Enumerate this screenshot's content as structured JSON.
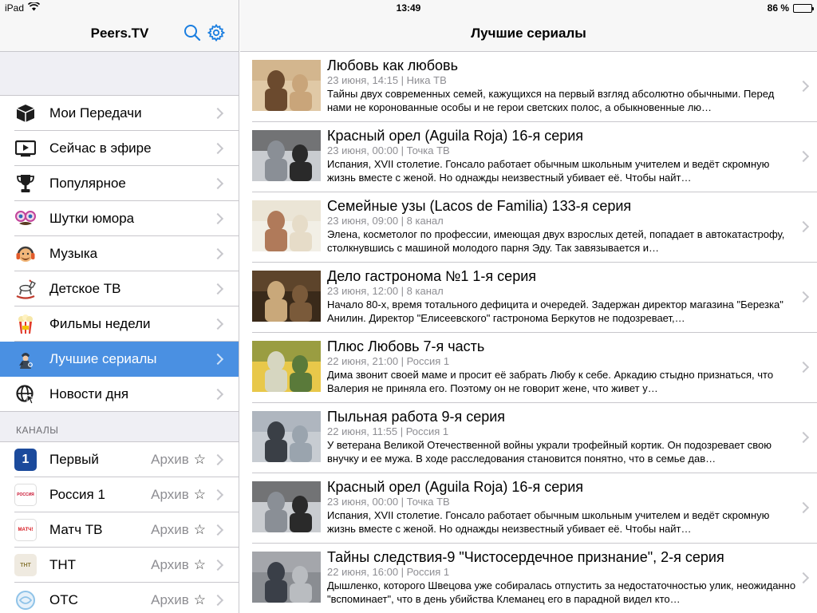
{
  "status": {
    "device": "iPad",
    "time": "13:49",
    "battery": "86 %",
    "battery_level": 0.86
  },
  "sidebar": {
    "title": "Peers.TV",
    "items": [
      {
        "label": "Мои Передачи",
        "icon": "box-icon"
      },
      {
        "label": "Сейчас в эфире",
        "icon": "tv-play-icon"
      },
      {
        "label": "Популярное",
        "icon": "trophy-icon"
      },
      {
        "label": "Шутки юмора",
        "icon": "funny-glasses-icon"
      },
      {
        "label": "Музыка",
        "icon": "headphones-face-icon"
      },
      {
        "label": "Детское ТВ",
        "icon": "rocking-horse-icon"
      },
      {
        "label": "Фильмы недели",
        "icon": "popcorn-icon"
      },
      {
        "label": "Лучшие сериалы",
        "icon": "sherlock-icon",
        "active": true
      },
      {
        "label": "Новости дня",
        "icon": "globe-cursor-icon"
      }
    ],
    "channels_header": "КАНАЛЫ",
    "channels": [
      {
        "name": "Первый",
        "archive": "Архив",
        "logo": "1",
        "logo_color": "#1b4a9c"
      },
      {
        "name": "Россия 1",
        "archive": "Архив",
        "logo": "РОССИЯ",
        "logo_color": "#c8102e"
      },
      {
        "name": "Матч ТВ",
        "archive": "Архив",
        "logo": "МАТЧ!",
        "logo_color": "#d71920"
      },
      {
        "name": "ТНТ",
        "archive": "Архив",
        "logo": "ТНТ",
        "logo_color": "#8a7a3a"
      },
      {
        "name": "ОТС",
        "archive": "Архив",
        "logo": "",
        "logo_color": "#8fc3e8"
      }
    ]
  },
  "main": {
    "title": "Лучшие сериалы",
    "rows": [
      {
        "title": "Любовь как любовь",
        "meta": "23 июня, 14:15 | Ника ТВ",
        "desc": "Тайны двух современных семей, кажущихся на первый взгляд абсолютно обычными. Перед нами не коронованные особы и не герои светских полос, а обыкновенные лю…",
        "palette": [
          "#c9a57a",
          "#6b4a2e",
          "#e0c9a6"
        ]
      },
      {
        "title": "Красный орел (Aguila Roja) 16-я серия",
        "meta": "23 июня, 00:00 | Точка ТВ",
        "desc": "Испания, XVII столетие. Гонсало работает обычным школьным учителем и ведёт скромную жизнь вместе с женой. Но однажды неизвестный убивает её. Чтобы найт…",
        "palette": [
          "#2a2a2a",
          "#8a8f96",
          "#c9ccd0"
        ]
      },
      {
        "title": "Семейные узы (Lacos de Familia) 133-я серия",
        "meta": "23 июня, 09:00 | 8 канал",
        "desc": "Элена, косметолог по профессии, имеющая двух взрослых детей, попадает в автокатастрофу, столкнувшись с машиной молодого парня Эду. Так завязывается и…",
        "palette": [
          "#e6dcc8",
          "#b07a5a",
          "#f2efe6"
        ]
      },
      {
        "title": "Дело гастронома №1 1-я серия",
        "meta": "23 июня, 12:00 | 8 канал",
        "desc": "Начало 80-х, время тотального дефицита и очередей. Задержан директор магазина \"Березка\" Анилин. Директор \"Елисеевского\" гастронома Беркутов не подозревает,…",
        "palette": [
          "#7a5a3a",
          "#c9a87a",
          "#3a2a1a"
        ]
      },
      {
        "title": "Плюс Любовь 7-я часть",
        "meta": "22 июня, 21:00 | Россия 1",
        "desc": "Дима звонит своей маме и просит её забрать Любу к себе. Аркадию стыдно признаться, что Валерия не приняла его. Поэтому он не говорит жене, что живет у…",
        "palette": [
          "#5a7a3a",
          "#d6d6c0",
          "#e8c84a"
        ]
      },
      {
        "title": "Пыльная работа 9-я серия",
        "meta": "22 июня, 11:55 | Россия 1",
        "desc": "У ветерана Великой Отечественной войны украли трофейный кортик. Он подозревает свою внучку и ее мужа. В ходе расследования становится понятно, что в семье дав…",
        "palette": [
          "#9aa4ae",
          "#3a3f46",
          "#c7ccd2"
        ]
      },
      {
        "title": "Красный орел (Aguila Roja) 16-я серия",
        "meta": "23 июня, 00:00 | Точка ТВ",
        "desc": "Испания, XVII столетие. Гонсало работает обычным школьным учителем и ведёт скромную жизнь вместе с женой. Но однажды неизвестный убивает её. Чтобы найт…",
        "palette": [
          "#2a2a2a",
          "#8a8f96",
          "#c9ccd0"
        ]
      },
      {
        "title": "Тайны следствия-9 \"Чистосердечное признание\", 2-я серия",
        "meta": "22 июня, 16:00 | Россия 1",
        "desc": "Дышленко, которого Швецова уже собиралась отпустить за недостаточностью улик, неожиданно \"вспоминает\", что в день убийства Клеманец его в парадной видел кто…",
        "palette": [
          "#b9bcc0",
          "#3a3f48",
          "#8a8d92"
        ]
      }
    ]
  }
}
